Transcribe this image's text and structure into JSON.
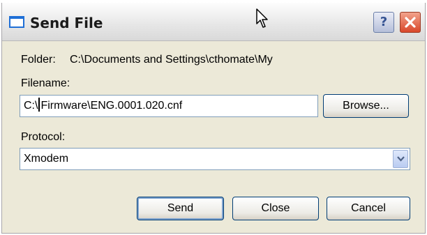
{
  "window": {
    "title": "Send File"
  },
  "folder": {
    "label": "Folder:",
    "value": "C:\\Documents and Settings\\cthomate\\My"
  },
  "filename": {
    "label": "Filename:",
    "value_before_caret": "C:\\",
    "value_after_caret": "Firmware\\ENG.0001.020.cnf"
  },
  "browse_button": {
    "label": "Browse..."
  },
  "protocol": {
    "label": "Protocol:",
    "selected": "Xmodem"
  },
  "buttons": {
    "send": "Send",
    "close": "Close",
    "cancel": "Cancel"
  },
  "titlebar_buttons": {
    "help": "?"
  },
  "icons": [
    "window-icon",
    "mouse-cursor-icon",
    "help-icon",
    "close-icon",
    "chevron-down-icon"
  ]
}
